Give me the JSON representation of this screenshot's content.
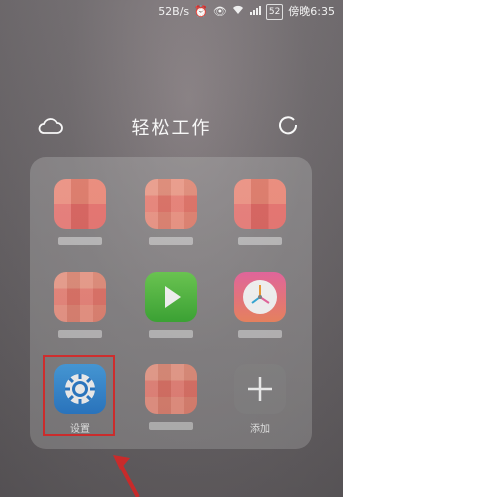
{
  "status_bar": {
    "speed": "52B/s",
    "network": "⁴⁶ᵢₗ",
    "battery": "52",
    "time": "傍晚6:35"
  },
  "folder": {
    "title": "轻松工作",
    "icons": {
      "cloud": "cloud-icon",
      "refresh": "refresh-icon"
    },
    "apps": [
      {
        "name": "blurred-app-1",
        "label": "",
        "icon": "pixelated"
      },
      {
        "name": "blurred-app-2",
        "label": "",
        "icon": "pixelated"
      },
      {
        "name": "blurred-app-3",
        "label": "",
        "icon": "pixelated"
      },
      {
        "name": "blurred-app-4",
        "label": "",
        "icon": "pixelated"
      },
      {
        "name": "video-app",
        "label": "",
        "icon": "play-icon"
      },
      {
        "name": "clock-app",
        "label": "",
        "icon": "clock-icon"
      },
      {
        "name": "settings-app",
        "label": "设置",
        "icon": "gear-icon"
      },
      {
        "name": "blurred-app-5",
        "label": "",
        "icon": "pixelated"
      },
      {
        "name": "add-app",
        "label": "添加",
        "icon": "plus-icon"
      }
    ]
  },
  "colors": {
    "highlight": "#e23030",
    "settings": "#2d7fd0",
    "play": "#3eae36",
    "clock": "#f06aa4"
  }
}
